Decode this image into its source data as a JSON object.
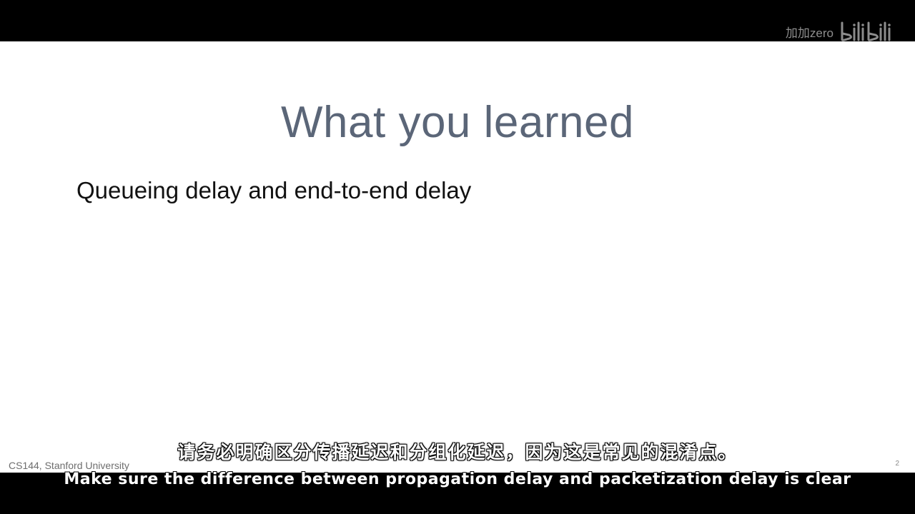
{
  "watermark": {
    "text": "加加zero",
    "logo_icon": "bilibili-logo-icon",
    "logo_text": "bilibili"
  },
  "slide": {
    "title": "What you learned",
    "bullet": "Queueing delay and end-to-end delay",
    "footer": "CS144, Stanford University",
    "page_number": "2"
  },
  "subtitles": {
    "chinese": "请务必明确区分传播延迟和分组化延迟，因为这是常见的混淆点。",
    "english": "Make sure the difference between propagation delay and packetization delay is clear"
  },
  "colors": {
    "title": "#5b6678",
    "bullet": "#111111",
    "background_letterbox": "#000000",
    "slide_background": "#ffffff"
  }
}
